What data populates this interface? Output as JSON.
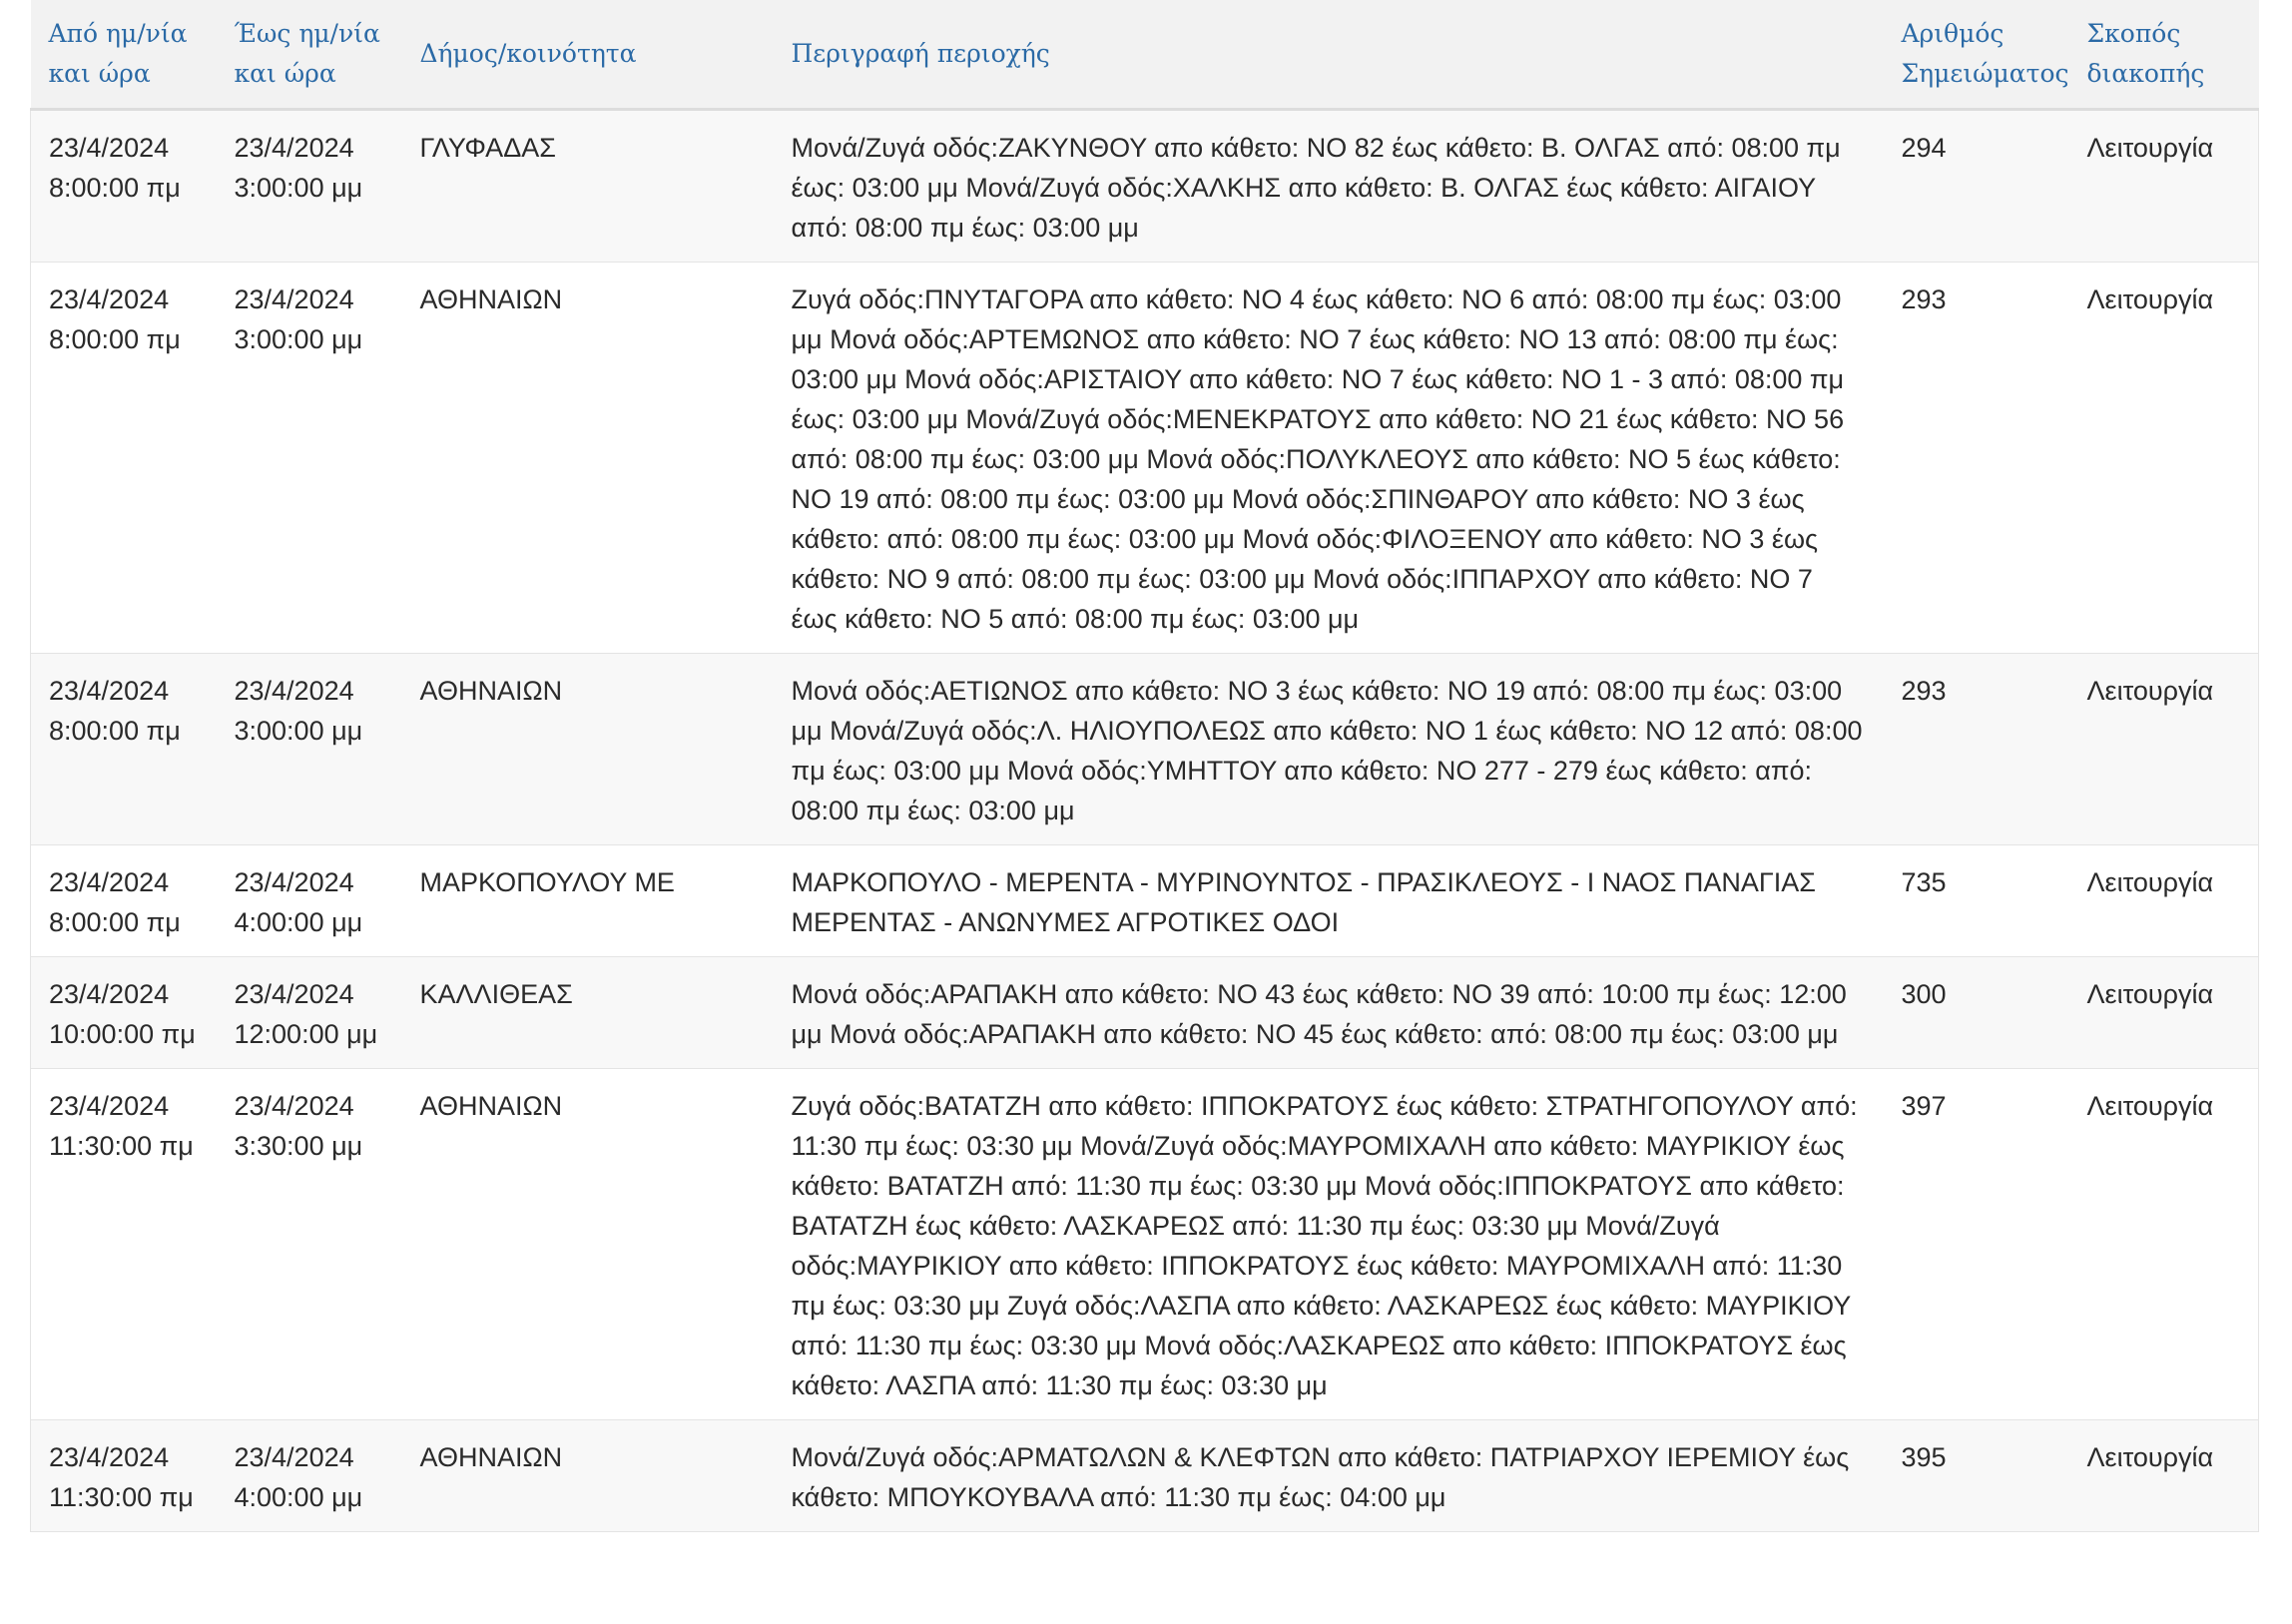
{
  "table": {
    "headers": {
      "from": [
        "Από ημ/νία",
        "και ώρα"
      ],
      "to": [
        "Έως ημ/νία",
        "και ώρα"
      ],
      "municipality": "Δήμος/κοινότητα",
      "description": "Περιγραφή περιοχής",
      "number": [
        "Αριθμός",
        "Σημειώματος"
      ],
      "purpose": [
        "Σκοπός",
        "διακοπής"
      ]
    },
    "rows": [
      {
        "from_date": "23/4/2024",
        "from_time": "8:00:00 πμ",
        "to_date": "23/4/2024",
        "to_time": "3:00:00 μμ",
        "municipality": "ΓΛΥΦΑΔΑΣ",
        "description": "Μονά/Ζυγά οδός:ΖΑΚΥΝΘΟΥ απο κάθετο: ΝΟ 82 έως κάθετο: Β. ΟΛΓΑΣ από: 08:00 πμ έως: 03:00 μμ Μονά/Ζυγά οδός:ΧΑΛΚΗΣ απο κάθετο: Β. ΟΛΓΑΣ έως κάθετο: ΑΙΓΑΙΟΥ από: 08:00 πμ έως: 03:00 μμ",
        "number": "294",
        "purpose": "Λειτουργία"
      },
      {
        "from_date": "23/4/2024",
        "from_time": "8:00:00 πμ",
        "to_date": "23/4/2024",
        "to_time": "3:00:00 μμ",
        "municipality": "ΑΘΗΝΑΙΩΝ",
        "description": "Ζυγά οδός:ΠΝΥΤΑΓΟΡΑ απο κάθετο: ΝΟ 4 έως κάθετο: ΝΟ 6 από: 08:00 πμ έως: 03:00 μμ Μονά οδός:ΑΡΤΕΜΩΝΟΣ απο κάθετο: ΝΟ 7 έως κάθετο: ΝΟ 13 από: 08:00 πμ έως: 03:00 μμ Μονά οδός:ΑΡΙΣΤΑΙΟΥ απο κάθετο: ΝΟ 7 έως κάθετο: ΝΟ 1 - 3 από: 08:00 πμ έως: 03:00 μμ Μονά/Ζυγά οδός:ΜΕΝΕΚΡΑΤΟΥΣ απο κάθετο: ΝΟ 21 έως κάθετο: ΝΟ 56 από: 08:00 πμ έως: 03:00 μμ Μονά οδός:ΠΟΛΥΚΛΕΟΥΣ απο κάθετο: ΝΟ 5 έως κάθετο: ΝΟ 19 από: 08:00 πμ έως: 03:00 μμ Μονά οδός:ΣΠΙΝΘΑΡΟΥ απο κάθετο: ΝΟ 3 έως κάθετο: από: 08:00 πμ έως: 03:00 μμ Μονά οδός:ΦΙΛΟΞΕΝΟΥ απο κάθετο: ΝΟ 3 έως κάθετο: ΝΟ 9 από: 08:00 πμ έως: 03:00 μμ Μονά οδός:ΙΠΠΑΡΧΟΥ απο κάθετο: ΝΟ 7 έως κάθετο: ΝΟ 5 από: 08:00 πμ έως: 03:00 μμ",
        "number": "293",
        "purpose": "Λειτουργία"
      },
      {
        "from_date": "23/4/2024",
        "from_time": "8:00:00 πμ",
        "to_date": "23/4/2024",
        "to_time": "3:00:00 μμ",
        "municipality": "ΑΘΗΝΑΙΩΝ",
        "description": "Μονά οδός:ΑΕΤΙΩΝΟΣ απο κάθετο: ΝΟ 3 έως κάθετο: ΝΟ 19 από: 08:00 πμ έως: 03:00 μμ Μονά/Ζυγά οδός:Λ. ΗΛΙΟΥΠΟΛΕΩΣ απο κάθετο: ΝΟ 1 έως κάθετο: ΝΟ 12 από: 08:00 πμ έως: 03:00 μμ Μονά οδός:ΥΜΗΤΤΟΥ απο κάθετο: ΝΟ 277 - 279 έως κάθετο: από: 08:00 πμ έως: 03:00 μμ",
        "number": "293",
        "purpose": "Λειτουργία"
      },
      {
        "from_date": "23/4/2024",
        "from_time": "8:00:00 πμ",
        "to_date": "23/4/2024",
        "to_time": "4:00:00 μμ",
        "municipality": "ΜΑΡΚΟΠΟΥΛΟΥ ΜΕ",
        "description": "ΜΑΡΚΟΠΟΥΛΟ - ΜΕΡΕΝΤΑ - ΜΥΡΙΝΟΥΝΤΟΣ - ΠΡΑΣΙΚΛΕΟΥΣ - Ι ΝΑΟΣ ΠΑΝΑΓΙΑΣ ΜΕΡΕΝΤΑΣ - ΑΝΩΝΥΜΕΣ ΑΓΡΟΤΙΚΕΣ ΟΔΟΙ",
        "number": "735",
        "purpose": "Λειτουργία"
      },
      {
        "from_date": "23/4/2024",
        "from_time": "10:00:00 πμ",
        "to_date": "23/4/2024",
        "to_time": "12:00:00 μμ",
        "municipality": "ΚΑΛΛΙΘΕΑΣ",
        "description": "Μονά οδός:ΑΡΑΠΑΚΗ απο κάθετο: ΝΟ 43 έως κάθετο: ΝΟ 39 από: 10:00 πμ έως: 12:00 μμ Μονά οδός:ΑΡΑΠΑΚΗ απο κάθετο: ΝΟ 45 έως κάθετο: από: 08:00 πμ έως: 03:00 μμ",
        "number": "300",
        "purpose": "Λειτουργία"
      },
      {
        "from_date": "23/4/2024",
        "from_time": "11:30:00 πμ",
        "to_date": "23/4/2024",
        "to_time": "3:30:00 μμ",
        "municipality": "ΑΘΗΝΑΙΩΝ",
        "description": "Ζυγά οδός:ΒΑΤΑΤΖΗ απο κάθετο: ΙΠΠΟΚΡΑΤΟΥΣ έως κάθετο: ΣΤΡΑΤΗΓΟΠΟΥΛΟΥ από: 11:30 πμ έως: 03:30 μμ Μονά/Ζυγά οδός:ΜΑΥΡΟΜΙΧΑΛΗ απο κάθετο: ΜΑΥΡΙΚΙΟΥ έως κάθετο: ΒΑΤΑΤΖΗ από: 11:30 πμ έως: 03:30 μμ Μονά οδός:ΙΠΠΟΚΡΑΤΟΥΣ απο κάθετο: ΒΑΤΑΤΖΗ έως κάθετο: ΛΑΣΚΑΡΕΩΣ από: 11:30 πμ έως: 03:30 μμ Μονά/Ζυγά οδός:ΜΑΥΡΙΚΙΟΥ απο κάθετο: ΙΠΠΟΚΡΑΤΟΥΣ έως κάθετο: ΜΑΥΡΟΜΙΧΑΛΗ από: 11:30 πμ έως: 03:30 μμ Ζυγά οδός:ΛΑΣΠΑ απο κάθετο: ΛΑΣΚΑΡΕΩΣ έως κάθετο: ΜΑΥΡΙΚΙΟΥ από: 11:30 πμ έως: 03:30 μμ Μονά οδός:ΛΑΣΚΑΡΕΩΣ απο κάθετο: ΙΠΠΟΚΡΑΤΟΥΣ έως κάθετο: ΛΑΣΠΑ από: 11:30 πμ έως: 03:30 μμ",
        "number": "397",
        "purpose": "Λειτουργία"
      },
      {
        "from_date": "23/4/2024",
        "from_time": "11:30:00 πμ",
        "to_date": "23/4/2024",
        "to_time": "4:00:00 μμ",
        "municipality": "ΑΘΗΝΑΙΩΝ",
        "description": "Μονά/Ζυγά οδός:ΑΡΜΑΤΩΛΩΝ & ΚΛΕΦΤΩΝ απο κάθετο: ΠΑΤΡΙΑΡΧΟΥ ΙΕΡΕΜΙΟΥ έως κάθετο: ΜΠΟΥΚΟΥΒΑΛΑ από: 11:30 πμ έως: 04:00 μμ",
        "number": "395",
        "purpose": "Λειτουργία"
      }
    ]
  }
}
